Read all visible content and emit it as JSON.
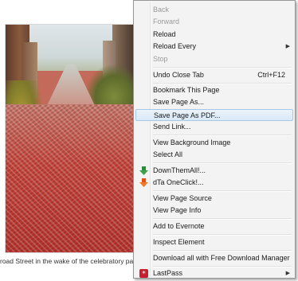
{
  "caption": "road Street in the wake of the celebratory parade.",
  "menu": {
    "back": "Back",
    "forward": "Forward",
    "reload": "Reload",
    "reload_every": "Reload Every",
    "stop": "Stop",
    "undo_close_tab": "Undo Close Tab",
    "undo_close_tab_shortcut": "Ctrl+F12",
    "bookmark_page": "Bookmark This Page",
    "save_page_as": "Save Page As...",
    "save_page_as_pdf": "Save Page As PDF...",
    "send_link": "Send Link...",
    "view_background_image": "View Background Image",
    "select_all": "Select All",
    "downthemall": "DownThemAll!...",
    "dta_oneclick": "dTa OneClick!...",
    "view_page_source": "View Page Source",
    "view_page_info": "View Page Info",
    "add_to_evernote": "Add to Evernote",
    "inspect_element": "Inspect Element",
    "download_all_fdm": "Download all with Free Download Manager",
    "lastpass": "LastPass"
  },
  "colors": {
    "highlight": "#d8e9f8",
    "downthemall_icon": "#2e8b3a",
    "dta_icon": "#e0501a",
    "lastpass_icon": "#c8202e"
  },
  "icons": {
    "downthemall": "downthemall-icon",
    "dta_oneclick": "dta-oneclick-icon",
    "lastpass": "lastpass-icon",
    "reload_every_arrow": "submenu-arrow-icon",
    "lastpass_arrow": "submenu-arrow-icon"
  }
}
